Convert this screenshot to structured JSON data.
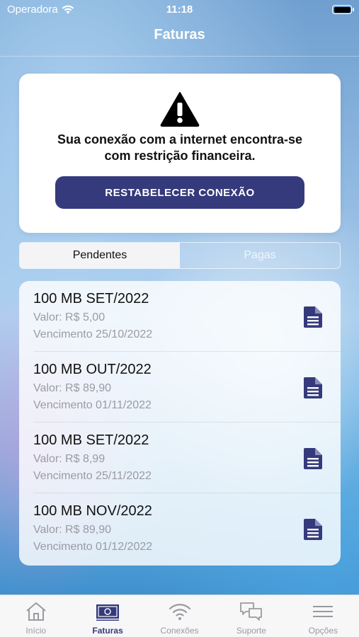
{
  "status_bar": {
    "carrier": "Operadora",
    "time": "11:18"
  },
  "nav": {
    "title": "Faturas"
  },
  "alert": {
    "message_line1": "Sua conexão com a internet encontra-se",
    "message_line2": "com restrição financeira.",
    "button_label": "RESTABELECER CONEXÃO"
  },
  "segments": {
    "pending": "Pendentes",
    "paid": "Pagas",
    "selected": "Pendentes"
  },
  "invoices": [
    {
      "title": "100 MB SET/2022",
      "value": "Valor: R$ 5,00",
      "due": "Vencimento 25/10/2022"
    },
    {
      "title": "100 MB OUT/2022",
      "value": "Valor: R$ 89,90",
      "due": "Vencimento 01/11/2022"
    },
    {
      "title": "100 MB SET/2022",
      "value": "Valor: R$ 8,99",
      "due": "Vencimento 25/11/2022"
    },
    {
      "title": "100 MB NOV/2022",
      "value": "Valor: R$ 89,90",
      "due": "Vencimento 01/12/2022"
    }
  ],
  "tabs": [
    {
      "label": "Início",
      "icon": "home-icon"
    },
    {
      "label": "Faturas",
      "icon": "invoice-icon",
      "active": true
    },
    {
      "label": "Conexões",
      "icon": "wifi-icon"
    },
    {
      "label": "Suporte",
      "icon": "chat-icon"
    },
    {
      "label": "Opções",
      "icon": "menu-icon"
    }
  ],
  "colors": {
    "accent": "#353a7c",
    "tab_inactive": "#9a9aa0",
    "secondary_text": "#9a9ba3"
  }
}
